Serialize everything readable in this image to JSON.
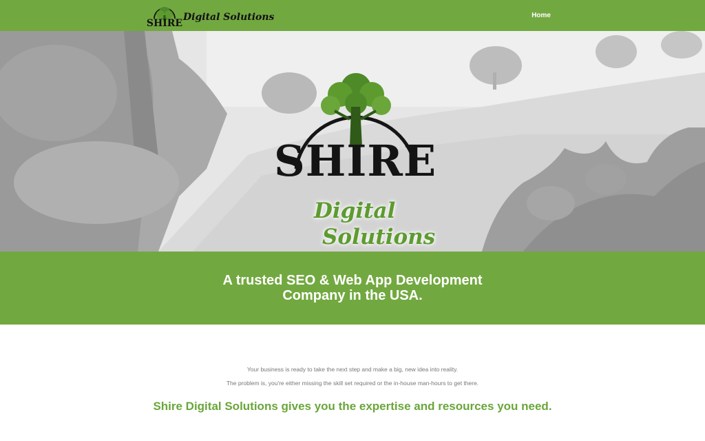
{
  "header": {
    "logo_mark": "SHIRE",
    "logo_text": "Digital Solutions",
    "nav": [
      {
        "label": "Home"
      }
    ]
  },
  "hero": {
    "logo_word": "SHIRE",
    "logo_line1": "Digital",
    "logo_line2": "Solutions"
  },
  "band": {
    "tagline": "A trusted SEO & Web App Development Company in the USA."
  },
  "content": {
    "paragraph1": "Your business is ready to take the next step and make a big, new idea into reality.",
    "paragraph2": "The problem is, you're either missing the skill set required or the in-house man-hours to get there.",
    "headline": "Shire Digital Solutions gives you the expertise and resources you need."
  },
  "colors": {
    "brand_green": "#72a840",
    "headline_green": "#6aa63a",
    "logo_green": "#5d9b2f"
  },
  "icons": [
    "tree-icon"
  ]
}
